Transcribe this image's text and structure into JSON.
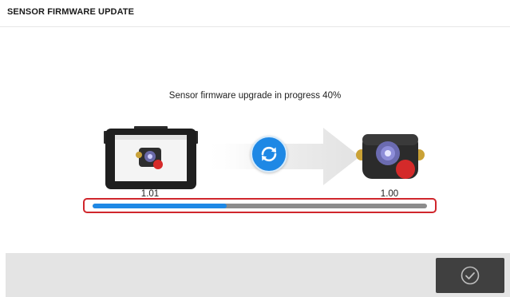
{
  "header": {
    "title": "SENSOR FIRMWARE UPDATE"
  },
  "main": {
    "status_text": "Sensor firmware upgrade in progress 40%",
    "progress": {
      "percent": 40,
      "fill_color": "#1e88e5",
      "track_color": "#8c8c8c",
      "frame_color": "#d0262c"
    },
    "source_device": {
      "version": "1.01",
      "icon": "tablet-device-icon"
    },
    "target_device": {
      "version": "1.00",
      "icon": "sensor-device-icon"
    },
    "sync_icon": "sync-icon",
    "transfer_arrow_icon": "transfer-arrow-icon"
  },
  "footer": {
    "confirm_icon": "check-circle-icon"
  },
  "colors": {
    "accent": "#1e88e5",
    "alert": "#d0262c",
    "footer_bg": "#e4e4e4",
    "button_bg": "#404040"
  }
}
